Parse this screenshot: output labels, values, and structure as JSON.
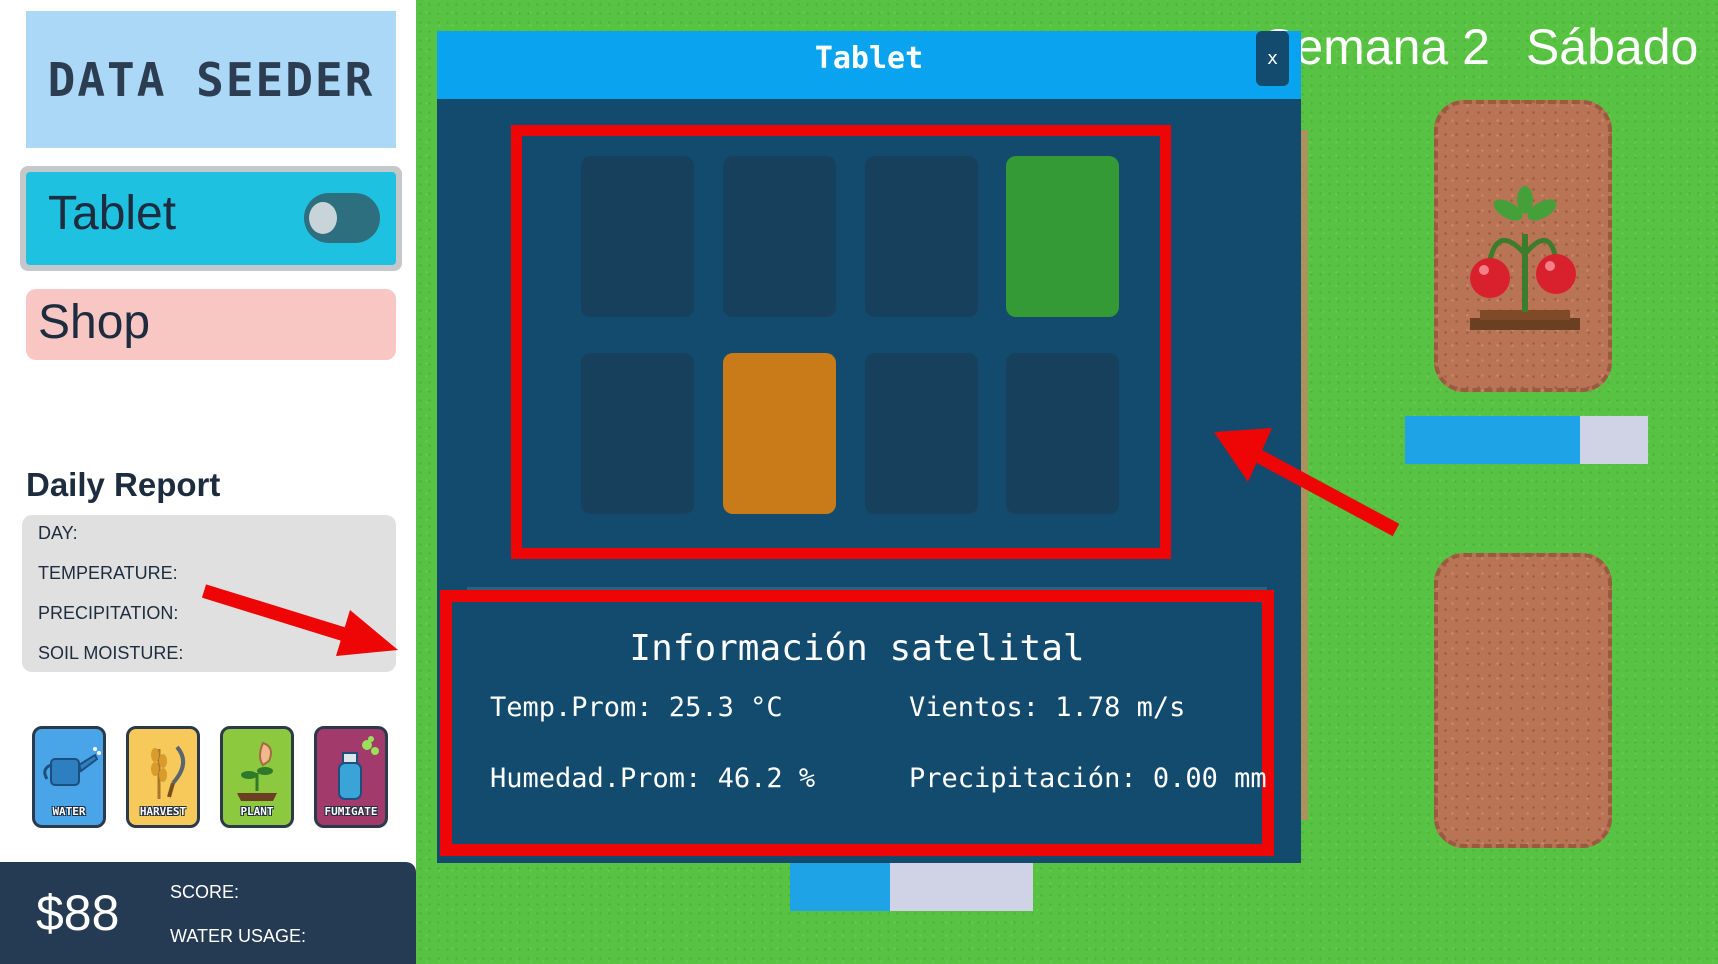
{
  "sidebar": {
    "logo": "DATA SEEDER",
    "tablet_label": "Tablet",
    "shop_label": "Shop",
    "report_title": "Daily Report",
    "report_rows": [
      "DAY:",
      "TEMPERATURE:",
      "PRECIPITATION:",
      "SOIL MOISTURE:"
    ],
    "tools": [
      {
        "label": "WATER",
        "icon": "watering-can-icon",
        "color": "#49a4e8"
      },
      {
        "label": "HARVEST",
        "icon": "wheat-sickle-icon",
        "color": "#f6c95a"
      },
      {
        "label": "PLANT",
        "icon": "plant-sprout-icon",
        "color": "#8cc93f"
      },
      {
        "label": "FUMIGATE",
        "icon": "spray-bottle-icon",
        "color": "#a23a6b"
      }
    ],
    "money": "$88",
    "score_label": "SCORE:",
    "water_usage_label": "WATER USAGE:"
  },
  "game": {
    "week": "Semana 2",
    "day": "Sábado",
    "crop_icon": "cherry-plant-icon",
    "progress_1_fraction": 0.72,
    "progress_2_fraction": 0.41
  },
  "tablet": {
    "title": "Tablet",
    "close_label": "x",
    "grid_colors": [
      "#17405c",
      "#17405c",
      "#17405c",
      "#339a35",
      "#17405c",
      "#c97b1a",
      "#17405c",
      "#17405c"
    ],
    "info_title": "Información satelital",
    "temp": "Temp.Prom: 25.3 °C",
    "wind": "Vientos: 1.78 m/s",
    "humidity": "Humedad.Prom: 46.2 %",
    "precip": "Precipitación: 0.00 mm"
  },
  "colors": {
    "highlight": "#ee0505",
    "grass": "#58c242",
    "modal": "#124b6e"
  }
}
